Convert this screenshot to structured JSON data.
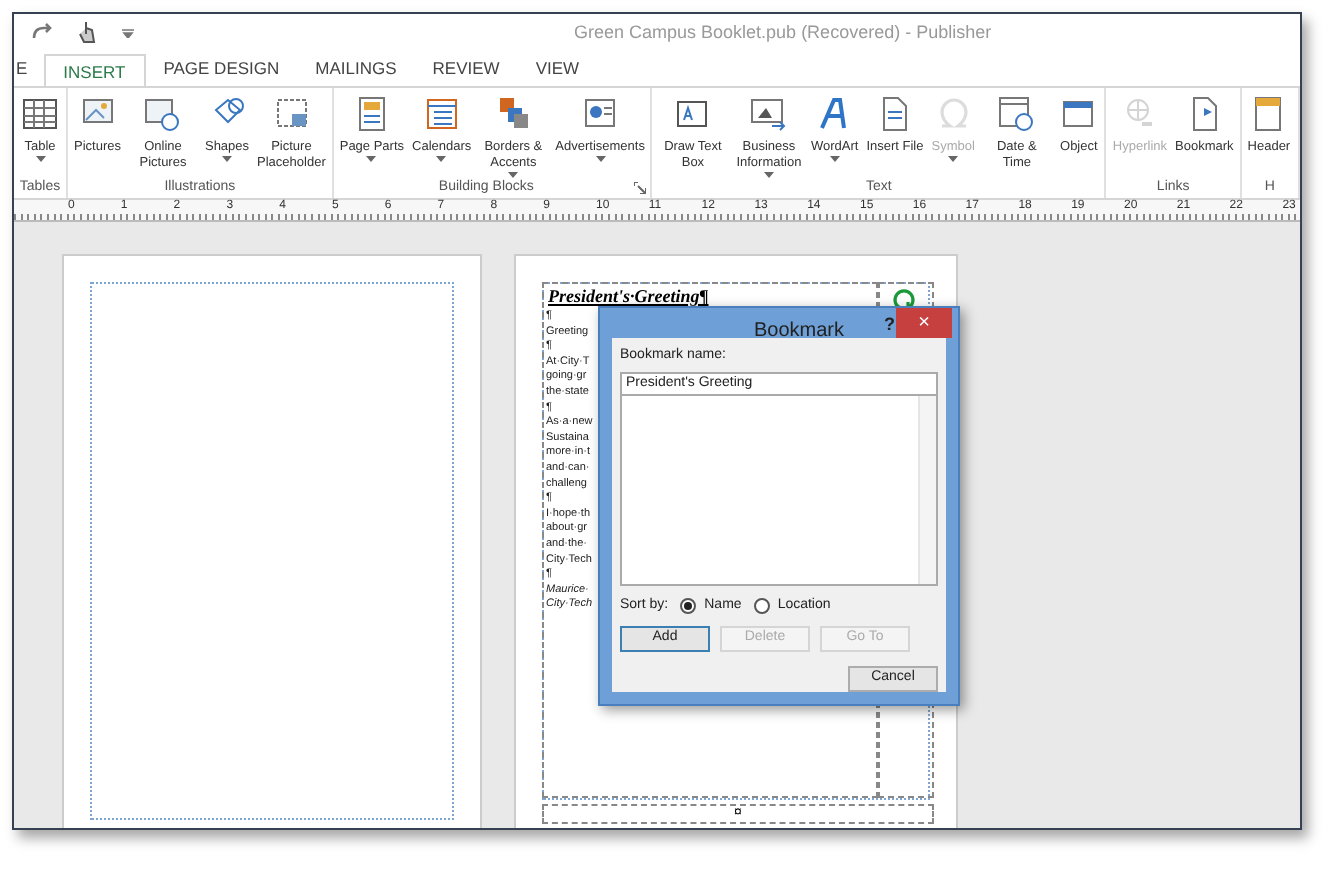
{
  "window": {
    "title": "Green Campus Booklet.pub (Recovered) - Publisher"
  },
  "tabs": [
    {
      "label": "E",
      "selected": false
    },
    {
      "label": "INSERT",
      "selected": true
    },
    {
      "label": "PAGE DESIGN",
      "selected": false
    },
    {
      "label": "MAILINGS",
      "selected": false
    },
    {
      "label": "REVIEW",
      "selected": false
    },
    {
      "label": "VIEW",
      "selected": false
    }
  ],
  "ribbon_groups": [
    {
      "label": "Tables",
      "launcher": false,
      "buttons": [
        {
          "label": "Table",
          "dropdown": true,
          "disabled": false
        }
      ]
    },
    {
      "label": "Illustrations",
      "launcher": false,
      "buttons": [
        {
          "label": "Pictures",
          "dropdown": false,
          "disabled": false
        },
        {
          "label": "Online Pictures",
          "dropdown": false,
          "disabled": false
        },
        {
          "label": "Shapes",
          "dropdown": true,
          "disabled": false
        },
        {
          "label": "Picture Placeholder",
          "dropdown": false,
          "disabled": false
        }
      ]
    },
    {
      "label": "Building Blocks",
      "launcher": true,
      "buttons": [
        {
          "label": "Page Parts",
          "dropdown": true,
          "disabled": false
        },
        {
          "label": "Calendars",
          "dropdown": true,
          "disabled": false
        },
        {
          "label": "Borders & Accents",
          "dropdown": true,
          "disabled": false
        },
        {
          "label": "Advertisements",
          "dropdown": true,
          "disabled": false
        }
      ]
    },
    {
      "label": "Text",
      "launcher": false,
      "buttons": [
        {
          "label": "Draw Text Box",
          "dropdown": false,
          "disabled": false
        },
        {
          "label": "Business Information",
          "dropdown": true,
          "disabled": false
        },
        {
          "label": "WordArt",
          "dropdown": true,
          "disabled": false
        },
        {
          "label": "Insert File",
          "dropdown": false,
          "disabled": false
        },
        {
          "label": "Symbol",
          "dropdown": true,
          "disabled": true
        },
        {
          "label": "Date & Time",
          "dropdown": false,
          "disabled": false
        },
        {
          "label": "Object",
          "dropdown": false,
          "disabled": false
        }
      ]
    },
    {
      "label": "Links",
      "launcher": false,
      "buttons": [
        {
          "label": "Hyperlink",
          "dropdown": false,
          "disabled": true
        },
        {
          "label": "Bookmark",
          "dropdown": false,
          "disabled": false
        }
      ]
    },
    {
      "label": "H",
      "launcher": false,
      "buttons": [
        {
          "label": "Header",
          "dropdown": false,
          "disabled": false
        }
      ]
    }
  ],
  "ruler": [
    "0",
    "1",
    "2",
    "3",
    "4",
    "5",
    "6",
    "7",
    "8",
    "9",
    "10",
    "11",
    "12",
    "13",
    "14",
    "15",
    "16",
    "17",
    "18",
    "19",
    "20",
    "21",
    "22",
    "23"
  ],
  "page": {
    "heading": "President's·Greeting¶",
    "lines": [
      {
        "text": "¶",
        "italic": false
      },
      {
        "text": "Greeting",
        "italic": false
      },
      {
        "text": "¶",
        "italic": false
      },
      {
        "text": "At·City·T",
        "italic": false
      },
      {
        "text": "going·gr",
        "italic": false
      },
      {
        "text": "the·state",
        "italic": false
      },
      {
        "text": "¶",
        "italic": false
      },
      {
        "text": "As·a·new",
        "italic": false
      },
      {
        "text": "Sustaina",
        "italic": false
      },
      {
        "text": "more·in·t",
        "italic": false
      },
      {
        "text": "and·can·",
        "italic": false
      },
      {
        "text": "challeng",
        "italic": false
      },
      {
        "text": "¶",
        "italic": false
      },
      {
        "text": "I·hope·th",
        "italic": false
      },
      {
        "text": "about·gr",
        "italic": false
      },
      {
        "text": "and·the·",
        "italic": false
      },
      {
        "text": "City·Tech",
        "italic": false
      },
      {
        "text": "¶",
        "italic": false
      },
      {
        "text": "Maurice·",
        "italic": true
      },
      {
        "text": "City·Tech",
        "italic": true
      }
    ],
    "footer_mark": "¤"
  },
  "dialog": {
    "title": "Bookmark",
    "help": "?",
    "close": "×",
    "name_label": "Bookmark name:",
    "name_value": "President's Greeting",
    "sort_label": "Sort by:",
    "sort_options": [
      {
        "label": "Name",
        "selected": true
      },
      {
        "label": "Location",
        "selected": false
      }
    ],
    "buttons": [
      {
        "label": "Add",
        "disabled": false
      },
      {
        "label": "Delete",
        "disabled": true
      },
      {
        "label": "Go To",
        "disabled": true
      }
    ],
    "cancel": "Cancel"
  }
}
